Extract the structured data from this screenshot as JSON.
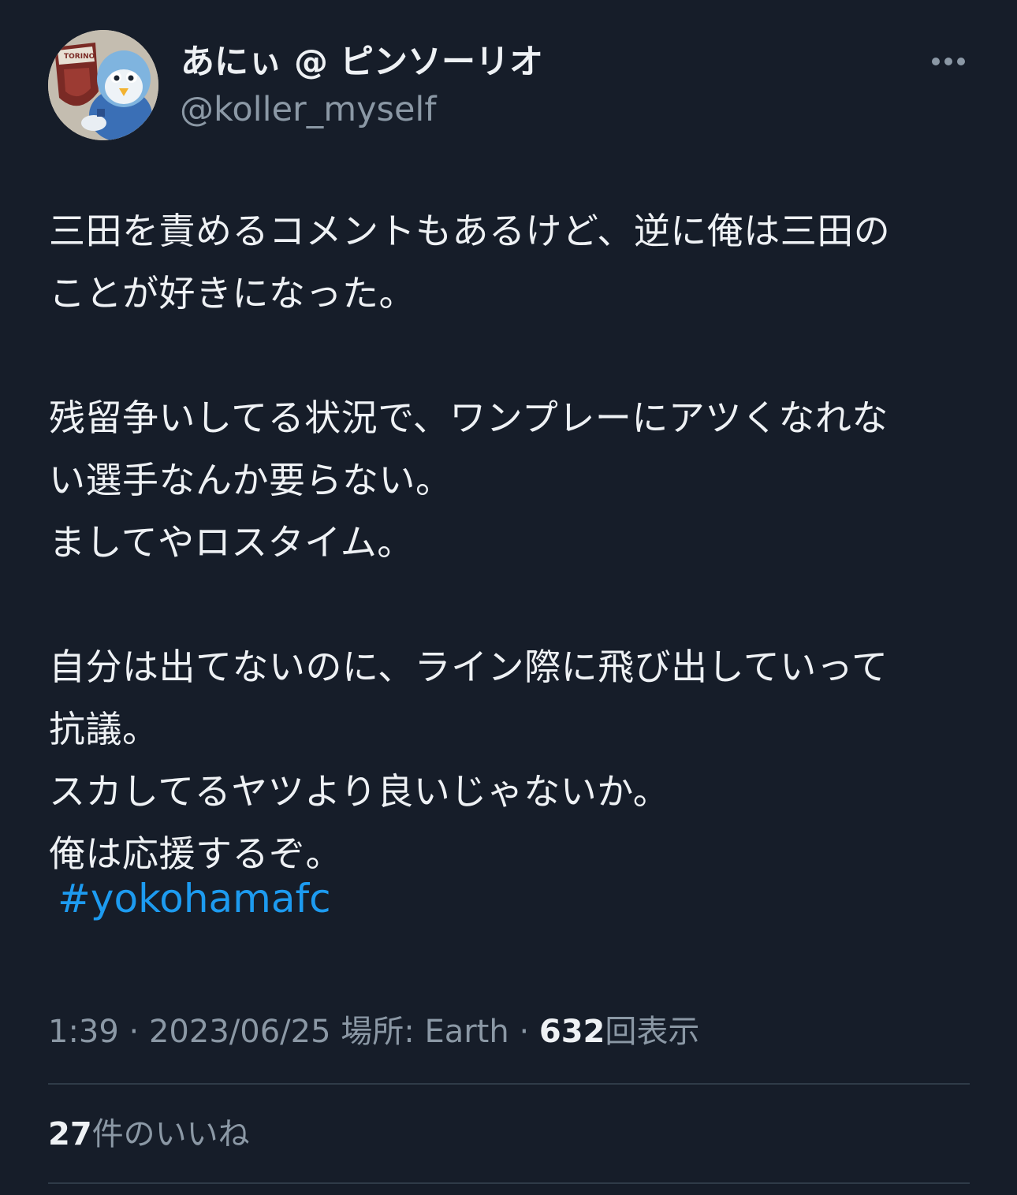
{
  "author": {
    "display_name": "あにぃ @ ピンソーリオ",
    "handle": "@koller_myself",
    "avatar_icon": "team-mascot-avatar-icon"
  },
  "more_icon": "more-horizontal-icon",
  "tweet": {
    "text": "三田を責めるコメントもあるけど、逆に俺は三田の\nことが好きになった。\n\n残留争いしてる状況で、ワンプレーにアツくなれな\nい選手なんか要らない。\nましてやロスタイム。\n\n自分は出てないのに、ライン際に飛び出していって\n抗議。\nスカしてるヤツより良いじゃないか。\n俺は応援するぞ。",
    "hashtag": "#yokohamafc"
  },
  "meta": {
    "time": "1:39",
    "sep1": "·",
    "date": "2023/06/25",
    "location_label": "場所: Earth",
    "sep2": "·",
    "views_count": "632",
    "views_label": "回表示"
  },
  "likes": {
    "count": "27",
    "label": "件のいいね"
  },
  "colors": {
    "background": "#161d29",
    "text_primary": "#eef1f4",
    "text_secondary": "#8b98a5",
    "link": "#1d9bf0",
    "divider": "#2f3b48"
  }
}
